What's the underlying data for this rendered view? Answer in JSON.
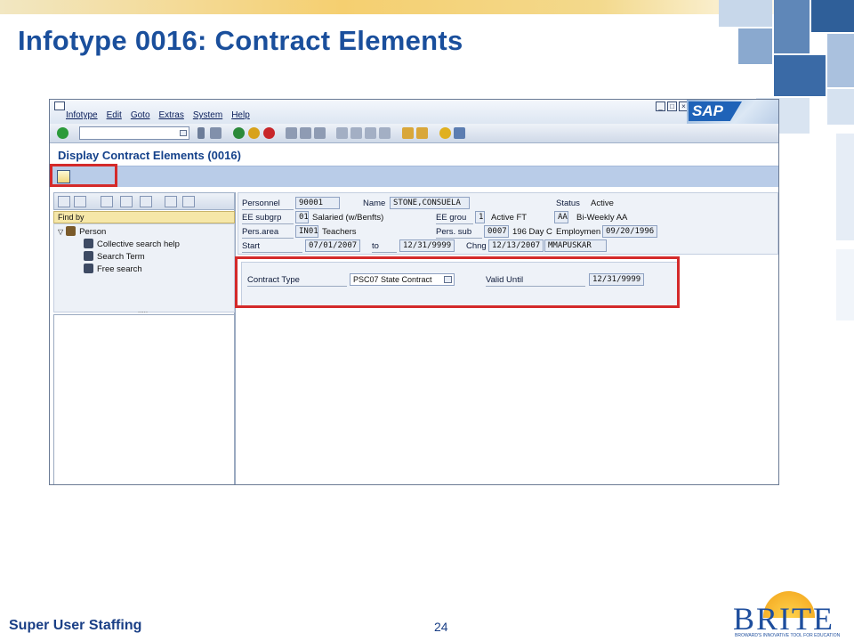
{
  "slide": {
    "title": "Infotype 0016: Contract Elements",
    "footer_left": "Super User Staffing",
    "page_number": "24",
    "logo_text": "BRITE",
    "logo_tagline": "BROWARD'S INNOVATIVE TOOL FOR EDUCATION"
  },
  "sap": {
    "menu": [
      "Infotype",
      "Edit",
      "Goto",
      "Extras",
      "System",
      "Help"
    ],
    "logo": "SAP",
    "screen_title": "Display Contract Elements (0016)"
  },
  "left_pane": {
    "find_by_label": "Find by",
    "tree_root": "Person",
    "tree_items": [
      "Collective search help",
      "Search Term",
      "Free search"
    ],
    "dots": "....."
  },
  "header": {
    "personnel_label": "Personnel",
    "personnel_value": "90001",
    "name_label": "Name",
    "name_value": "STONE,CONSUELA",
    "status_label": "Status",
    "status_value": "Active",
    "ee_subgrp_label": "EE subgrp",
    "ee_subgrp_code": "01",
    "ee_subgrp_text": "Salaried (w/Benfts)",
    "ee_grou_label": "EE grou",
    "ee_grou_code": "1",
    "ee_grou_text": "Active FT",
    "payroll_code": "AA",
    "payroll_text": "Bi-Weekly AA",
    "pers_area_label": "Pers.area",
    "pers_area_code": "IN01",
    "pers_area_text": "Teachers",
    "pers_sub_label": "Pers. sub",
    "pers_sub_code": "0007",
    "pers_sub_text": "196 Day C",
    "employment_label": "Employmen",
    "employment_value": "09/20/1996",
    "start_label": "Start",
    "start_value": "07/01/2007",
    "to_label": "to",
    "to_value": "12/31/9999",
    "chng_label": "Chng",
    "chng_date": "12/13/2007",
    "chng_user": "MMAPUSKAR"
  },
  "contract": {
    "type_label": "Contract Type",
    "type_value": "PSC07 State Contract",
    "valid_label": "Valid Until",
    "valid_value": "12/31/9999"
  },
  "colors": {
    "title_blue": "#1a4f9c",
    "highlight_red": "#d42a2a",
    "sap_title": "#15428b"
  }
}
